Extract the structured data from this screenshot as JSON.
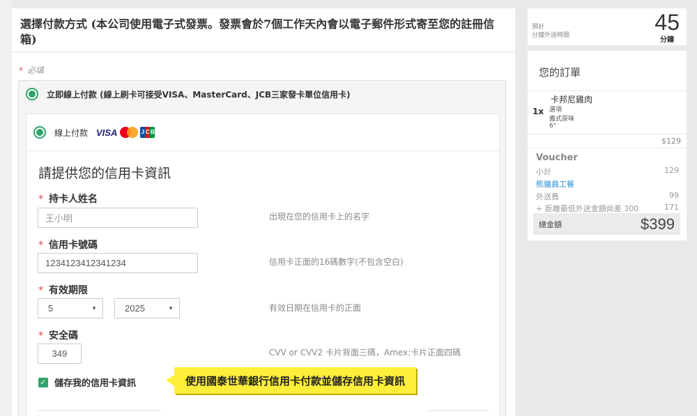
{
  "main": {
    "title": "選擇付款方式 (本公司使用電子式發票。發票會於7個工作天內會以電子郵件形式寄至您的註冊信箱)",
    "required_note": "必填",
    "payment_option": "立即線上付款 (線上刷卡可接受VISA、MasterCard、JCB三家發卡單位信用卡)",
    "method_label": "線上付款",
    "card_logos": {
      "visa": "VISA",
      "jcb": "JCB"
    },
    "cc_title": "請提供您的信用卡資訊",
    "fields": {
      "name": {
        "label": "持卡人姓名",
        "value": "王小明",
        "hint": "出現在您的信用卡上的名字"
      },
      "number": {
        "label": "信用卡號碼",
        "value": "1234123412341234",
        "hint": "信用卡正面的16碼數字(不包含空白)"
      },
      "expiry": {
        "label": "有效期限",
        "month": "5",
        "year": "2025",
        "hint": "有效日期在信用卡的正面"
      },
      "cvv": {
        "label": "安全碼",
        "value": "349",
        "hint": "CVV or CVV2 卡片背面三碼，Amex:卡片正面四碼"
      }
    },
    "save_card_label": "儲存我的信用卡資訊",
    "tooltip": "使用國泰世華銀行信用卡付款並儲存信用卡資訊"
  },
  "eta": {
    "label_line1": "預計",
    "label_line2": "分鐘外送時間",
    "minutes": "45",
    "unit": "分鐘"
  },
  "order": {
    "title": "您的訂單",
    "item": {
      "qty": "1x",
      "name": "卡邦尼雞肉",
      "sub1": "選項",
      "sub2": "義式原味",
      "sub3": "6\"",
      "price": "$129"
    },
    "voucher_label": "Voucher",
    "subtotal_label": "小計",
    "subtotal_value": "129",
    "promo_label": "熊貓員工餐",
    "delivery_label": "外送費",
    "delivery_value": "99",
    "min_diff_label": "+ 距離最低外送金額尚差 300",
    "min_diff_value": "171",
    "total_label": "總金額",
    "total_value": "$399"
  },
  "colors": {
    "accent_green": "#2fa36b",
    "required_red": "#d9534f",
    "tooltip_yellow": "#ffef3a",
    "link_blue": "#2a8fd2"
  }
}
